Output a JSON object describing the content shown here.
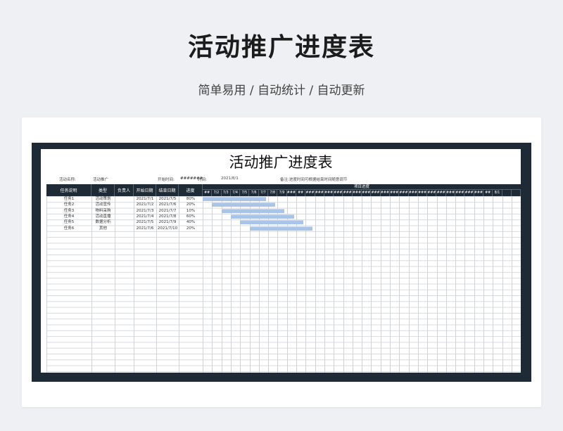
{
  "hero": {
    "title": "活动推广进度表",
    "subtitle": "简单易用 / 自动统计 / 自动更新"
  },
  "sheet": {
    "title": "活动推广进度表",
    "activity_name_label": "活动名称:",
    "activity_name_value": "活动推广",
    "start_time_label": "开始时间:",
    "start_time_value": "#######",
    "time_label": "时间:",
    "time_value": "2021/8/1",
    "note": "备注:进度时间可根据结束时间随意调节",
    "project_progress_label": "项目进度",
    "columns": [
      "任务说明",
      "类型",
      "负责人",
      "开始日期",
      "结束日期",
      "进度"
    ],
    "date_headers": [
      "##",
      "7/2",
      "7/3",
      "7/4",
      "7/5",
      "7/6",
      "7/7",
      "7/8",
      "7/9",
      "###",
      "##",
      "###",
      "###",
      "###",
      "###",
      "###",
      "###",
      "###",
      "###",
      "###",
      "###",
      "###",
      "###",
      "###",
      "###",
      "###",
      "###",
      "###",
      "###",
      "###",
      "##",
      "8/1",
      "",
      ""
    ],
    "tasks": [
      {
        "name": "任务1",
        "type": "活动策划",
        "owner": "",
        "start": "2021/7/1",
        "end": "2021/7/5",
        "progress": "80%",
        "bar_start_day": 0,
        "bar_days": 5
      },
      {
        "name": "任务2",
        "type": "活动宣传",
        "owner": "",
        "start": "2021/7/2",
        "end": "2021/7/6",
        "progress": "20%",
        "bar_start_day": 1,
        "bar_days": 5
      },
      {
        "name": "任务3",
        "type": "物料采购",
        "owner": "",
        "start": "2021/7/3",
        "end": "2021/7/7",
        "progress": "10%",
        "bar_start_day": 2,
        "bar_days": 5
      },
      {
        "name": "任务4",
        "type": "活动直播",
        "owner": "",
        "start": "2021/7/4",
        "end": "2021/7/8",
        "progress": "60%",
        "bar_start_day": 3,
        "bar_days": 5
      },
      {
        "name": "任务5",
        "type": "数据分析",
        "owner": "",
        "start": "2021/7/5",
        "end": "2021/7/9",
        "progress": "40%",
        "bar_start_day": 4,
        "bar_days": 5
      },
      {
        "name": "任务6",
        "type": "其他",
        "owner": "",
        "start": "2021/7/6",
        "end": "2021/7/10",
        "progress": "20%",
        "bar_start_day": 5,
        "bar_days": 5
      }
    ]
  }
}
